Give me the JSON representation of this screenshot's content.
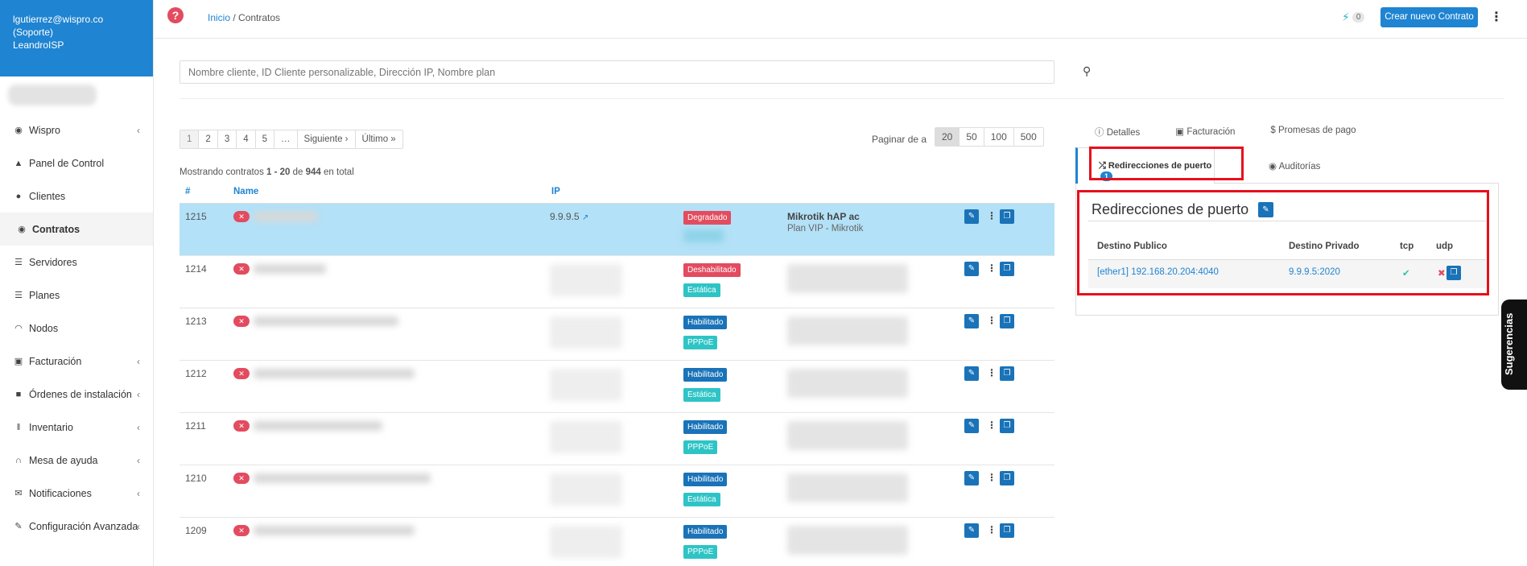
{
  "user": {
    "email": "lgutierrez@wispro.co",
    "role": "(Soporte)",
    "company": "LeandroISP"
  },
  "sidebar": {
    "items": [
      {
        "label": "Wispro",
        "icon": "eye-icon"
      },
      {
        "label": "Panel de Control",
        "icon": "chart-icon"
      },
      {
        "label": "Clientes",
        "icon": "users-icon"
      },
      {
        "label": "Contratos",
        "icon": "handshake-icon"
      },
      {
        "label": "Servidores",
        "icon": "server-icon"
      },
      {
        "label": "Planes",
        "icon": "list-icon"
      },
      {
        "label": "Nodos",
        "icon": "wifi-icon"
      },
      {
        "label": "Facturación",
        "icon": "money-icon"
      },
      {
        "label": "Órdenes de instalación",
        "icon": "truck-icon"
      },
      {
        "label": "Inventario",
        "icon": "barcode-icon"
      },
      {
        "label": "Mesa de ayuda",
        "icon": "headset-icon"
      },
      {
        "label": "Notificaciones",
        "icon": "envelope-icon"
      },
      {
        "label": "Configuración Avanzada",
        "icon": "wrench-icon"
      }
    ]
  },
  "header": {
    "breadcrumb_home": "Inicio",
    "breadcrumb_sep": " / ",
    "breadcrumb_current": "Contratos",
    "notif_count": "0",
    "new_contract": "Crear nuevo Contrato"
  },
  "search": {
    "placeholder": "Nombre cliente, ID Cliente personalizable, Dirección IP, Nombre plan"
  },
  "pagination": {
    "pages": [
      "1",
      "2",
      "3",
      "4",
      "5",
      "…",
      "Siguiente ›",
      "Último »"
    ],
    "per_page_label": "Paginar de a",
    "per_page": [
      "20",
      "50",
      "100",
      "500"
    ]
  },
  "summary": {
    "prefix": "Mostrando contratos ",
    "range": "1 - 20",
    "mid": " de ",
    "total": "944",
    "suffix": " en total"
  },
  "table": {
    "headers": {
      "id": "#",
      "name": "Name",
      "ip": "IP"
    },
    "rows": [
      {
        "id": "1215",
        "ip": "9.9.9.5",
        "status": "Degradado",
        "status_color": "red",
        "plan": "Mikrotik hAP ac",
        "plan_sub": "Plan VIP - Mikrotik"
      },
      {
        "id": "1214",
        "status": "Deshabilitado",
        "status_color": "red",
        "type": "Estática"
      },
      {
        "id": "1213",
        "status": "Habilitado",
        "status_color": "blue",
        "type": "PPPoE"
      },
      {
        "id": "1212",
        "status": "Habilitado",
        "status_color": "blue",
        "type": "Estática"
      },
      {
        "id": "1211",
        "status": "Habilitado",
        "status_color": "blue",
        "type": "PPPoE"
      },
      {
        "id": "1210",
        "status": "Habilitado",
        "status_color": "blue",
        "type": "Estática"
      },
      {
        "id": "1209",
        "status": "Habilitado",
        "status_color": "blue",
        "type": "PPPoE"
      }
    ]
  },
  "detail": {
    "tabs": [
      "Detalles",
      "Facturación",
      "Promesas de pago"
    ],
    "tab_active": "Redirecciones de puerto",
    "tab_active_count": "1",
    "tab_audits": "Auditorías",
    "panel_title": "Redirecciones de puerto",
    "columns": [
      "Destino Publico",
      "Destino Privado",
      "tcp",
      "udp"
    ],
    "rows": [
      {
        "public": "[ether1] 192.168.20.204:4040",
        "private": "9.9.9.5:2020",
        "tcp": "✔",
        "udp": "✖"
      }
    ]
  },
  "feedback": {
    "label": "Sugerencias"
  },
  "colors": {
    "primary": "#1f84d1",
    "danger": "#e34b5f",
    "highlight_row": "#b3e1f7",
    "annotation": "#e6101d"
  }
}
